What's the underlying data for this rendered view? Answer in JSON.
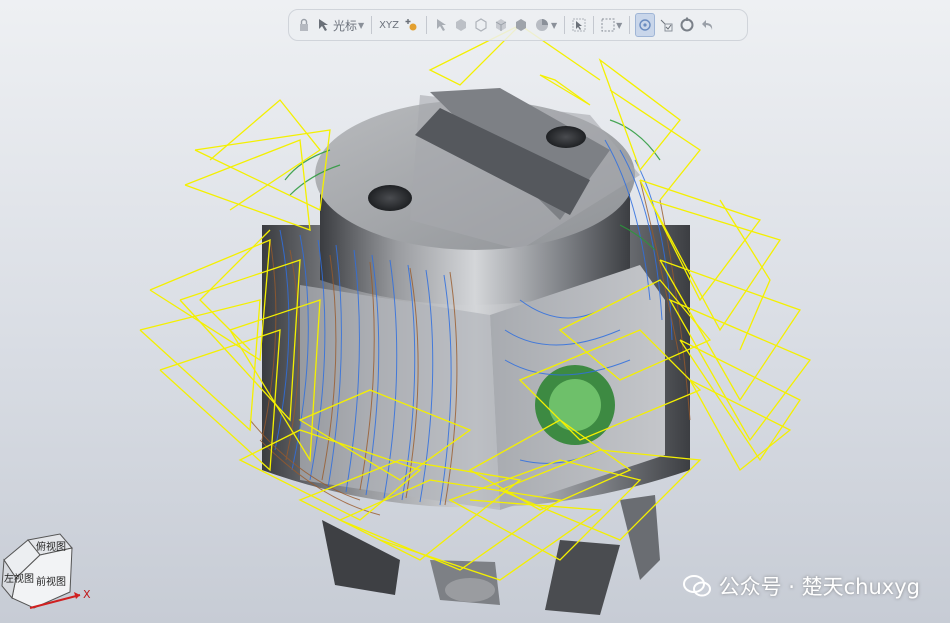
{
  "toolbar": {
    "cursor_label": "光标",
    "xyz_label": "XYZ",
    "buttons": [
      "lock-icon",
      "select-cursor-icon",
      "xyz-axis-icon",
      "add-point-icon",
      "arrow-select-icon",
      "shade-box-icon",
      "wire-box-icon",
      "solid-box-icon",
      "hidden-box-icon",
      "color-sphere-icon",
      "select-arrow-icon",
      "frame-select-icon",
      "view-zoom-icon",
      "check-view-icon",
      "rotate-view-icon",
      "undo-arrow-icon"
    ]
  },
  "view_cube": {
    "top_label": "俯视图",
    "left_label": "左视图",
    "front_label": "前视图",
    "x_axis_label": "X"
  },
  "watermark": {
    "text": "公众号 · 楚天chuxyg"
  },
  "colors": {
    "toolpath_yellow": "#f4f000",
    "toolpath_blue": "#2f6fe0",
    "toolpath_brown": "#9a5a2a",
    "toolpath_green": "#2a9a3a",
    "part_steel": "#8a8d92"
  }
}
